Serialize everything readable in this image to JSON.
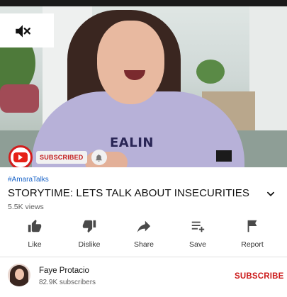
{
  "video": {
    "shirt_text": "EALIN",
    "mute_icon": "volume-off-icon",
    "overlay": {
      "subscribed_label": "SUBSCRIBED",
      "logo_icon": "youtube-icon",
      "bell_icon": "bell-icon"
    }
  },
  "meta": {
    "hashtag": "#AmaraTalks",
    "title": "STORYTIME: LETS TALK ABOUT INSECURITIES",
    "views": "5.5K views",
    "expand_icon": "chevron-down-icon"
  },
  "actions": [
    {
      "label": "Like",
      "icon": "thumbs-up-icon"
    },
    {
      "label": "Dislike",
      "icon": "thumbs-down-icon"
    },
    {
      "label": "Share",
      "icon": "share-icon"
    },
    {
      "label": "Save",
      "icon": "playlist-add-icon"
    },
    {
      "label": "Report",
      "icon": "flag-icon"
    }
  ],
  "channel": {
    "name": "Faye Protacio",
    "subscribers": "82.9K subscribers",
    "subscribe_label": "SUBSCRIBE"
  },
  "colors": {
    "accent_red": "#cc1b1b",
    "hashtag_blue": "#1a64c8",
    "icon_gray": "#4a4a4a"
  }
}
